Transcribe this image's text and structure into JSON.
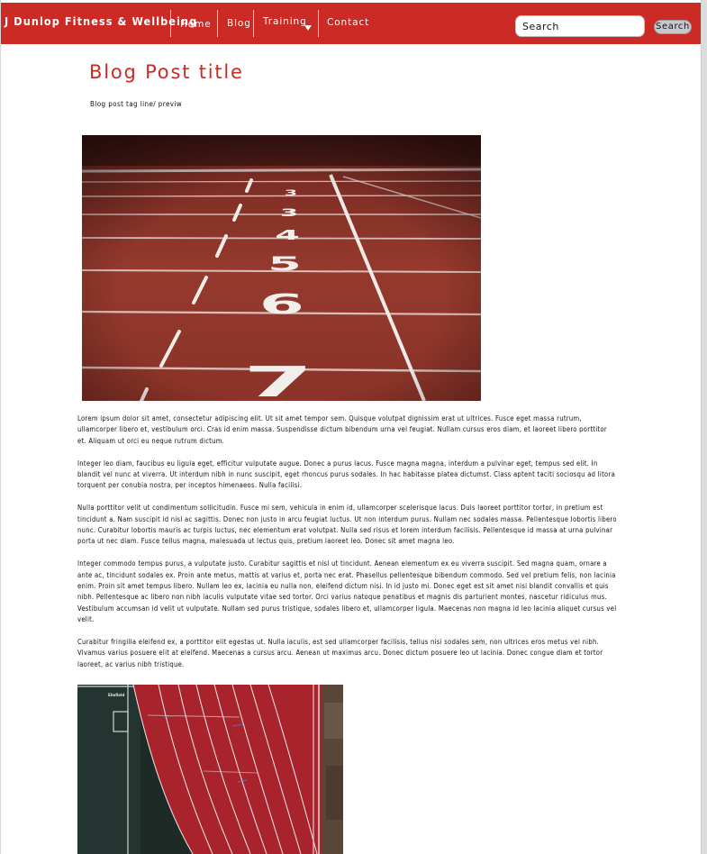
{
  "window": {
    "title": "J Dunlop Fitness & Wellbeing"
  },
  "nav": {
    "brand": "J Dunlop Fitness & Wellbeing",
    "items": [
      {
        "label": "Home"
      },
      {
        "label": "Blog"
      },
      {
        "label": "Training",
        "has_dropdown": true
      },
      {
        "label": "Contact"
      }
    ],
    "search": {
      "placeholder": "Search",
      "button_label": "Search"
    },
    "accent_color": "#cc2a24"
  },
  "post": {
    "title": "Blog Post title",
    "tagline": "Blog post tag line/ previw",
    "hero_image": {
      "description_icon": "running-track-lanes-image",
      "lane_numbers": [
        "3",
        "4",
        "5",
        "6",
        "7"
      ]
    },
    "paragraphs": [
      "Lorem ipsum dolor sit amet, consectetur adipiscing elit. Ut sit amet tempor sem. Quisque volutpat dignissim erat ut ultrices. Fusce eget massa rutrum, ullamcorper libero et, vestibulum orci. Cras id enim massa. Suspendisse dictum bibendum urna vel feugiat. Nullam cursus eros diam, et laoreet libero porttitor et. Aliquam ut orci eu neque rutrum dictum.",
      "Integer leo diam, faucibus eu ligula eget, efficitur vulputate augue. Donec a purus lacus. Fusce magna magna, interdum a pulvinar eget, tempus sed elit. In blandit vel nunc at viverra. Ut interdum nibh in nunc suscipit, eget rhoncus purus sodales. In hac habitasse platea dictumst. Class aptent taciti sociosqu ad litora torquent per conubia nostra, per inceptos himenaeos. Nulla facilisi.",
      "Nulla porttitor velit ut condimentum sollicitudin. Fusce mi sem, vehicula in enim id, ullamcorper scelerisque lacus. Duis laoreet porttitor tortor, in pretium est tincidunt a. Nam suscipit id nisl ac sagittis. Donec non justo in arcu feugiat luctus. Ut non interdum purus. Nullam nec sodales massa. Pellentesque lobortis libero nunc. Curabitur lobortis mauris ac turpis luctus, nec elementum erat volutpat. Nulla sed risus et lorem interdum facilisis. Pellentesque id massa at urna pulvinar porta ut nec diam. Fusce tellus magna, malesuada ut lectus quis, pretium laoreet leo. Donec sit amet magna leo.",
      "Integer commodo tempus purus, a vulputate justo. Curabitur sagittis et nisl ut tincidunt. Aenean elementum ex eu viverra suscipit. Sed magna quam, ornare a ante ac, tincidunt sodales ex. Proin ante metus, mattis at varius et, porta nec erat. Phasellus pellentesque bibendum commodo. Sed vel pretium felis, non lacinia enim. Proin sit amet tempus libero. Nullam leo ex, lacinia eu nulla non, eleifend dictum nisi. In id justo mi. Donec eget est sit amet nisi blandit convallis et quis nibh. Pellentesque ac libero non nibh iaculis vulputate vitae sed tortor. Orci varius natoque penatibus et magnis dis parturient montes, nascetur ridiculus mus. Vestibulum accumsan id velit ut vulputate. Nullam sed purus tristique, sodales libero et, ullamcorper ligula. Maecenas non magna id leo lacinia aliquet cursus vel velit.",
      "Curabitur fringilla eleifend ex, a porttitor elit egestas ut. Nulla iaculis, est sed ullamcorper facilisis, tellus nisi sodales sem, non ultrices eros metus vel nibh. Vivamus varius posuere elit at eleifend. Maecenas a cursus arcu. Aenean ut maximus arcu. Donec dictum posuere leo ut lacinia. Donec congue diam et tortor laoreet, ac varius nibh tristique."
    ],
    "second_image": {
      "description_icon": "aerial-running-track-image"
    }
  }
}
